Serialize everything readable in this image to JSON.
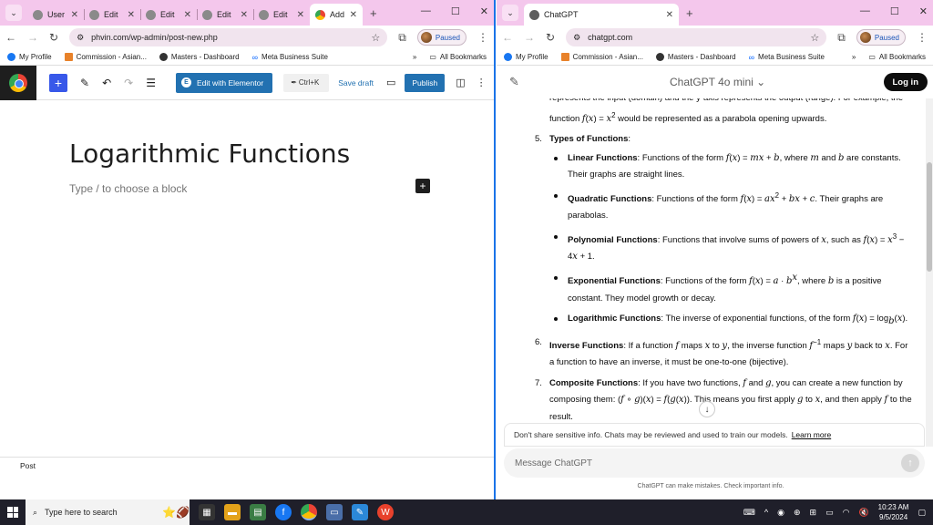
{
  "left_window": {
    "tabs": [
      {
        "label": "User"
      },
      {
        "label": "Edit"
      },
      {
        "label": "Edit"
      },
      {
        "label": "Edit"
      },
      {
        "label": "Edit"
      },
      {
        "label": "Add",
        "active": true
      }
    ],
    "url": "phvin.com/wp-admin/post-new.php",
    "paused_label": "Paused",
    "bookmarks": [
      "My Profile",
      "Commission - Asian...",
      "Masters - Dashboard",
      "Meta Business Suite"
    ],
    "all_bookmarks": "All Bookmarks",
    "editor": {
      "elementor_label": "Edit with Elementor",
      "cmdk_label": "Ctrl+K",
      "save_draft": "Save draft",
      "publish": "Publish",
      "post_title": "Logarithmic Functions",
      "block_placeholder": "Type / to choose a block",
      "footer_label": "Post"
    }
  },
  "right_window": {
    "tab_title": "ChatGPT",
    "url": "chatgpt.com",
    "paused_label": "Paused",
    "bookmarks": [
      "My Profile",
      "Commission - Asian...",
      "Masters - Dashboard",
      "Meta Business Suite"
    ],
    "all_bookmarks": "All Bookmarks",
    "model_label": "ChatGPT 4o mini",
    "login_label": "Log in",
    "notice_text": "Don't share sensitive info. Chats may be reviewed and used to train our models.",
    "notice_link": "Learn more",
    "input_placeholder": "Message ChatGPT",
    "disclaimer": "ChatGPT can make mistakes. Check important info."
  },
  "taskbar": {
    "search_placeholder": "Type here to search",
    "time": "10:23 AM",
    "date": "9/5/2024"
  },
  "colors": {
    "tabstrip": "#f4c7ec",
    "wp_blue": "#2271b1",
    "wp_inserter": "#3858e9",
    "taskbar": "#1f1f2a"
  }
}
